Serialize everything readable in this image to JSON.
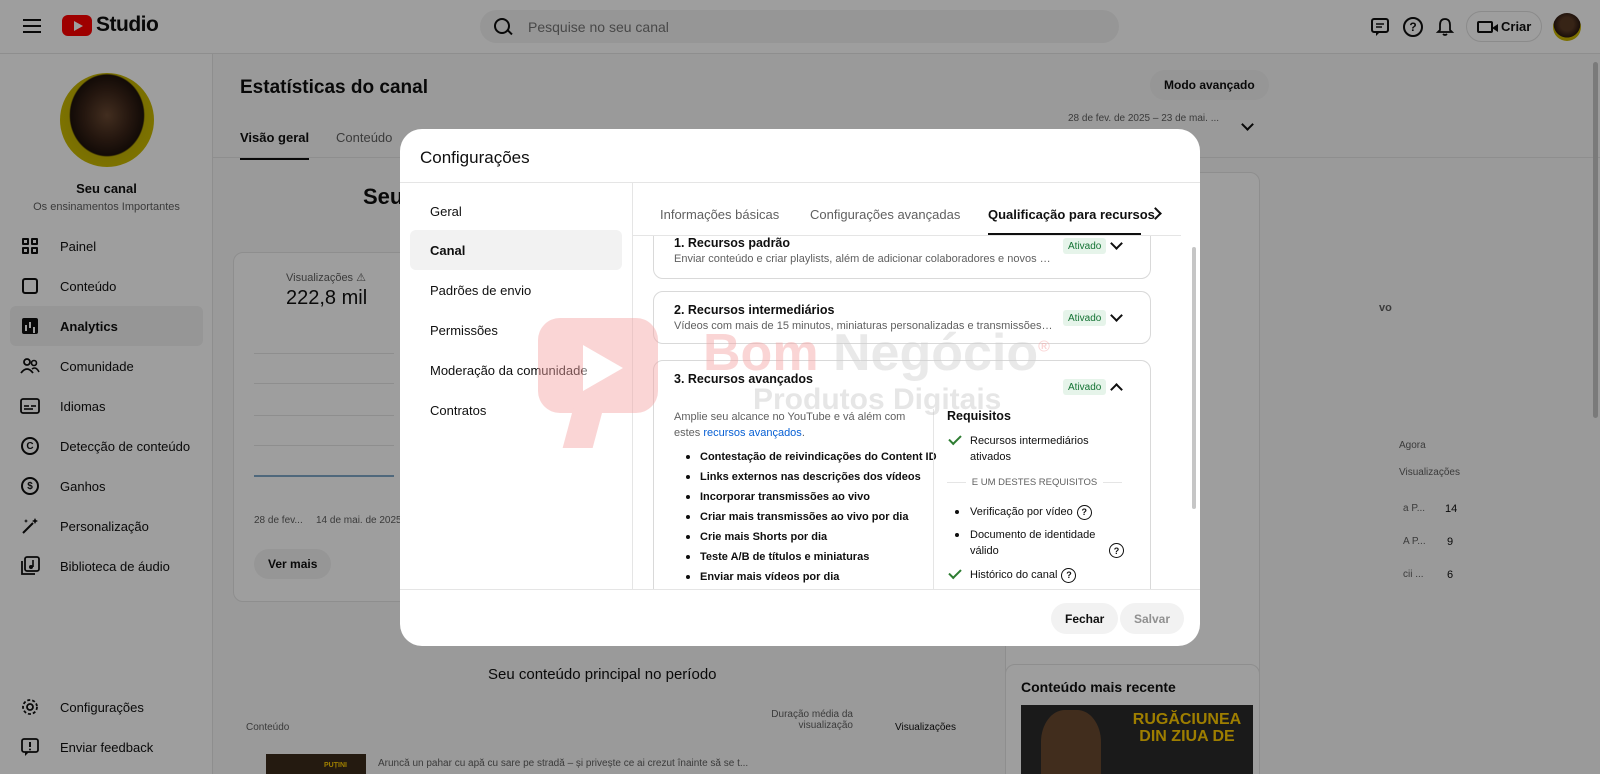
{
  "topbar": {
    "brand": "Studio",
    "search_placeholder": "Pesquise no seu canal",
    "create_label": "Criar"
  },
  "sidebar": {
    "channel_name": "Seu canal",
    "channel_subtitle": "Os ensinamentos Importantes",
    "items": [
      {
        "label": "Painel",
        "icon": "dashboard-icon"
      },
      {
        "label": "Conteúdo",
        "icon": "content-icon"
      },
      {
        "label": "Analytics",
        "icon": "analytics-icon"
      },
      {
        "label": "Comunidade",
        "icon": "community-icon"
      },
      {
        "label": "Idiomas",
        "icon": "subtitles-icon"
      },
      {
        "label": "Detecção de conteúdo",
        "icon": "copyright-icon"
      },
      {
        "label": "Ganhos",
        "icon": "dollar-icon"
      },
      {
        "label": "Personalização",
        "icon": "customization-icon"
      },
      {
        "label": "Biblioteca de áudio",
        "icon": "audio-library-icon"
      }
    ],
    "bottom_items": [
      {
        "label": "Configurações",
        "icon": "gear-icon"
      },
      {
        "label": "Enviar feedback",
        "icon": "feedback-icon"
      }
    ]
  },
  "main": {
    "title": "Estatísticas do canal",
    "advanced_mode": "Modo avançado",
    "date_range": "28 de fev. de 2025 – 23 de mai. ...",
    "tabs": [
      "Visão geral",
      "Conteúdo"
    ],
    "heading_partial": "Seu",
    "stat_label": "Visualizações",
    "stat_value": "222,8 mil",
    "axis_labels": [
      "28 de fev...",
      "14 de mai. de 2025"
    ],
    "see_more": "Ver mais",
    "top_content_title": "Seu conteúdo principal no período",
    "col_content": "Conteúdo",
    "col_avg_duration": "Duração média da visualização",
    "col_views": "Visualizações",
    "bottom_row_text": "Aruncă un pahar cu apă cu sare pe stradă – și privește ce ai crezut înainte să se t...",
    "right_now": "Agora",
    "right_views": "Visualizações",
    "right_rows": [
      {
        "title": "a P...",
        "value": "14"
      },
      {
        "title": "A P...",
        "value": "9"
      },
      {
        "title": "cii ...",
        "value": "6"
      }
    ],
    "right_pill_partial": "vo",
    "recent_title": "Conteúdo mais recente",
    "recent_thumb_text": "RUGĂCIUNEA DIN ZIUA DE",
    "bottom_thumb_text": "PUȚINI OAMENI"
  },
  "dialog": {
    "title": "Configurações",
    "nav": [
      "Geral",
      "Canal",
      "Padrões de envio",
      "Permissões",
      "Moderação da comunidade",
      "Contratos"
    ],
    "tabs": [
      "Informações básicas",
      "Configurações avançadas",
      "Qualificação para recursos"
    ],
    "resources": [
      {
        "title": "1. Recursos padrão",
        "desc": "Enviar conteúdo e criar playlists, além de adicionar colaboradores e novos vídeos",
        "status": "Ativado"
      },
      {
        "title": "2. Recursos intermediários",
        "desc": "Vídeos com mais de 15 minutos, miniaturas personalizadas e transmissões ao vivo",
        "status": "Ativado"
      },
      {
        "title": "3. Recursos avançados",
        "status": "Ativado"
      }
    ],
    "advanced_intro": "Amplie seu alcance no YouTube e vá além com estes ",
    "advanced_link": "recursos avançados",
    "advanced_period": ".",
    "advanced_features": [
      "Contestação de reivindicações do Content ID",
      "Links externos nas descrições dos vídeos",
      "Incorporar transmissões ao vivo",
      "Criar mais transmissões ao vivo por dia",
      "Crie mais Shorts por dia",
      "Teste A/B de títulos e miniaturas",
      "Enviar mais vídeos por dia"
    ],
    "requirements_title": "Requisitos",
    "req_met": "Recursos intermediários ativados",
    "req_or": "E UM DESTES REQUISITOS",
    "req_options": [
      "Verificação por vídeo",
      "Documento de identidade válido",
      "Histórico do canal"
    ],
    "close_label": "Fechar",
    "save_label": "Salvar"
  },
  "watermark": {
    "title_a": "Bom ",
    "title_b": "Negócio",
    "registered": "®",
    "subtitle": "Produtos Digitais"
  }
}
